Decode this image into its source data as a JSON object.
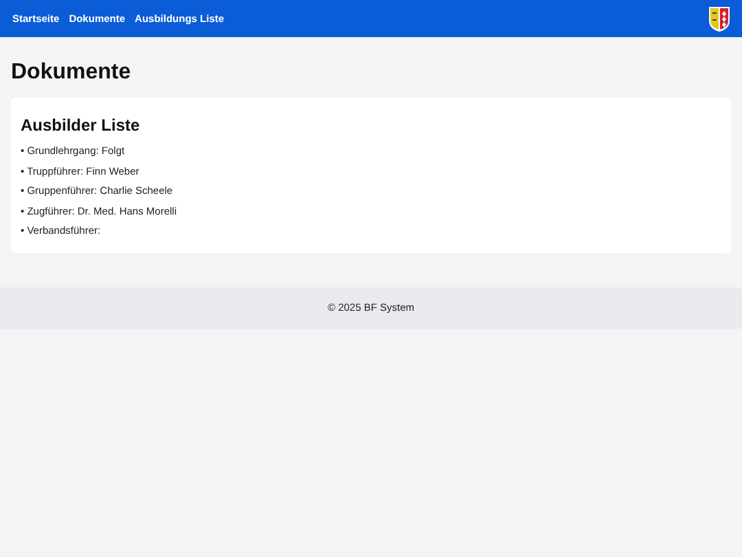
{
  "nav": {
    "links": [
      {
        "label": "Startseite"
      },
      {
        "label": "Dokumente"
      },
      {
        "label": "Ausbildungs Liste"
      }
    ]
  },
  "page_title": "Dokumente",
  "card": {
    "title": "Ausbilder Liste",
    "items": [
      "• Grundlehrgang: Folgt",
      "• Truppführer: Finn Weber",
      "• Gruppenführer: Charlie Scheele",
      "• Zugführer: Dr. Med. Hans Morelli",
      "• Verbandsführer:"
    ]
  },
  "footer": "© 2025 BF System"
}
